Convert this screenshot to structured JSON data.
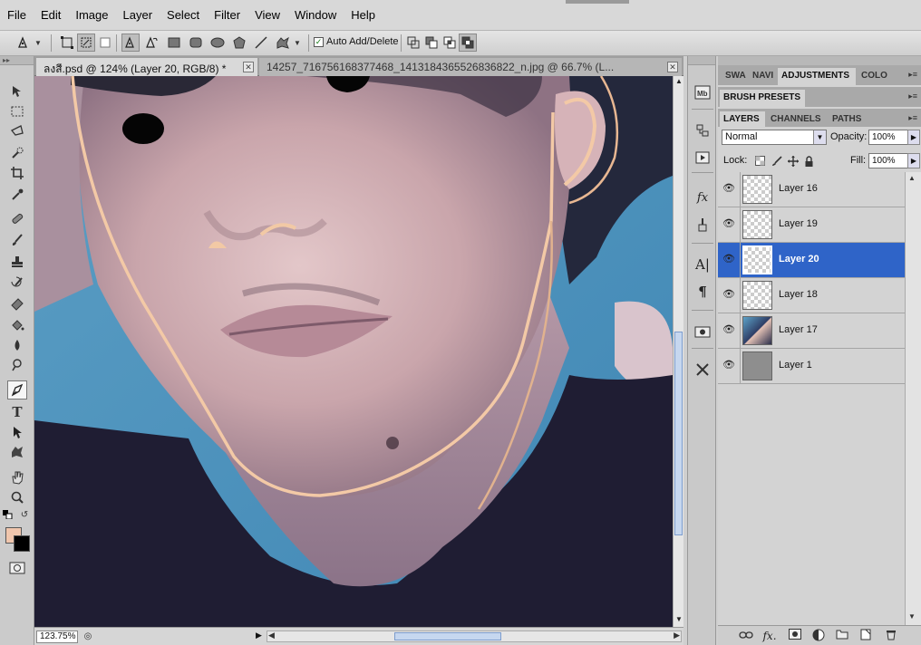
{
  "menu": [
    "File",
    "Edit",
    "Image",
    "Layer",
    "Select",
    "Filter",
    "View",
    "Window",
    "Help"
  ],
  "options": {
    "auto_add_delete_label": "Auto Add/Delete",
    "auto_add_delete_checked": true
  },
  "tabs": {
    "active": "ลงสี.psd @ 124% (Layer 20, RGB/8) *",
    "inactive": "14257_716756168377468_1413184365526836822_n.jpg @ 66.7% (L..."
  },
  "status": {
    "zoom": "123.75%"
  },
  "colors": {
    "foreground": "#f0c6ad",
    "background": "#000000",
    "selected_row": "#2f64c8",
    "path_stroke": "#f3c9a6"
  },
  "panels": {
    "top_tabs": [
      "SWA",
      "NAVI",
      "ADJUSTMENTS",
      "COLO"
    ],
    "brush_presets": "BRUSH PRESETS",
    "layer_tabs": [
      "LAYERS",
      "CHANNELS",
      "PATHS"
    ],
    "blend_mode": "Normal",
    "opacity_label": "Opacity:",
    "opacity_value": "100%",
    "lock_label": "Lock:",
    "fill_label": "Fill:",
    "fill_value": "100%"
  },
  "layers": [
    {
      "name": "Layer 16",
      "thumb": "transparent",
      "visible": true,
      "selected": false
    },
    {
      "name": "Layer 19",
      "thumb": "transparent",
      "visible": true,
      "selected": false
    },
    {
      "name": "Layer 20",
      "thumb": "transparent",
      "visible": true,
      "selected": true
    },
    {
      "name": "Layer 18",
      "thumb": "transparent",
      "visible": true,
      "selected": false
    },
    {
      "name": "Layer 17",
      "thumb": "photo",
      "visible": true,
      "selected": false
    },
    {
      "name": "Layer 1",
      "thumb": "gray",
      "visible": true,
      "selected": false
    }
  ],
  "icons": {
    "toolbox": [
      "move-icon",
      "marquee-icon",
      "lasso-icon",
      "quick-select-icon",
      "crop-icon",
      "eyedropper-icon",
      "healing-brush-icon",
      "brush-icon",
      "clone-stamp-icon",
      "history-brush-icon",
      "eraser-icon",
      "paint-bucket-icon",
      "blur-icon",
      "dodge-icon",
      "pen-icon",
      "type-icon",
      "path-select-icon",
      "shape-icon",
      "hand-icon",
      "zoom-icon"
    ],
    "strip": [
      "mini-bridge-icon",
      "history-icon",
      "actions-icon",
      "styles-icon",
      "tool-presets-icon",
      "character-icon",
      "paragraph-icon",
      "clone-source-icon",
      "tools-icon"
    ],
    "footer": [
      "link-layers-icon",
      "fx-icon",
      "add-mask-icon",
      "adjustment-layer-icon",
      "new-group-icon",
      "new-layer-icon",
      "delete-layer-icon"
    ]
  }
}
